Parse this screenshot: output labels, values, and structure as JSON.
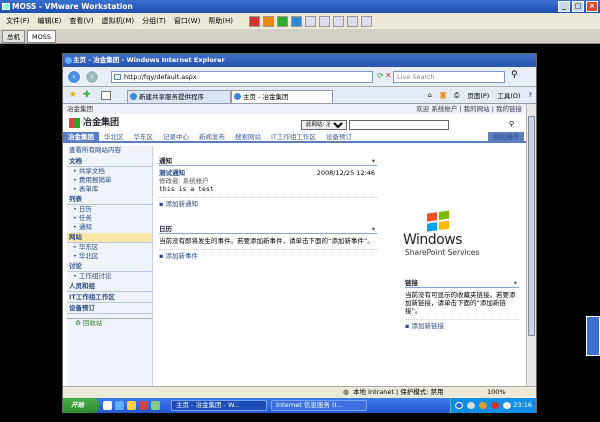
{
  "vmware": {
    "title": "MOSS - VMware Workstation",
    "menu": [
      "文件(F)",
      "编辑(E)",
      "查看(V)",
      "虚拟机(M)",
      "分组(T)",
      "窗口(W)",
      "帮助(H)"
    ],
    "tabs": [
      "总机",
      "MOSS"
    ]
  },
  "ie": {
    "title": "主页 - 冶金集团 - Windows Internet Explorer",
    "address": "http://fqy/default.aspx",
    "search_placeholder": "Live Search",
    "tabs": [
      "新建共享服务提供程序",
      "主页 - 冶金集团"
    ],
    "commands": [
      "页面(P)",
      "工具(O)"
    ],
    "status": {
      "zone": "本地 Intranet | 保护模式: 禁用",
      "zoom": "100%"
    }
  },
  "page": {
    "breadcrumb": "冶金集团",
    "top_links": "欢迎 系统帐户 | 我的网站 | 我的链接",
    "site_name": "冶金集团",
    "search_scope": "此网站: 冶金集团",
    "nav": [
      "冶金集团",
      "华北区",
      "华东区",
      "记录中心",
      "新闻发布",
      "搜索网站",
      "IT工作组工作区",
      "设备预订"
    ],
    "site_actions": "网站操作",
    "quick_launch": {
      "view_all": "查看所有网站内容",
      "sections": [
        {
          "heading": "文档",
          "items": [
            "共享文档",
            "费用报销单",
            "表单库"
          ]
        },
        {
          "heading": "列表",
          "items": [
            "日历",
            "任务",
            "通知"
          ]
        },
        {
          "heading": "网站",
          "items": [
            "华东区",
            "华北区"
          ]
        },
        {
          "heading": "讨论",
          "items": [
            "工作组讨论"
          ]
        },
        {
          "heading": "人员和组",
          "items": []
        },
        {
          "heading": "IT工作组工作区",
          "items": []
        },
        {
          "heading": "设备预订",
          "items": []
        }
      ],
      "recycle": "回收站"
    },
    "announcements": {
      "title": "通知",
      "item_title": "测试通知",
      "author": "修改者: 系统帐户",
      "date": "2008/12/25 12:46",
      "body": "this is a test",
      "add": "添加新通知"
    },
    "calendar": {
      "title": "日历",
      "empty": "当前没有即将发生的事件。若要添加新事件，请单击下面的“添加新事件”。",
      "add": "添加新事件"
    },
    "links": {
      "title": "链接",
      "empty": "当前没有可显示的收藏夹链接。若要添加新链接，请单击下面的“添加新链接”。",
      "add": "添加新链接"
    },
    "logo_text_1": "Windows",
    "logo_text_2": "SharePoint Services"
  },
  "taskbar": {
    "start": "开始",
    "tasks": [
      "主页 - 冶金集团 - W...",
      "Internet 信息服务 (I..."
    ],
    "time": "23:16"
  }
}
